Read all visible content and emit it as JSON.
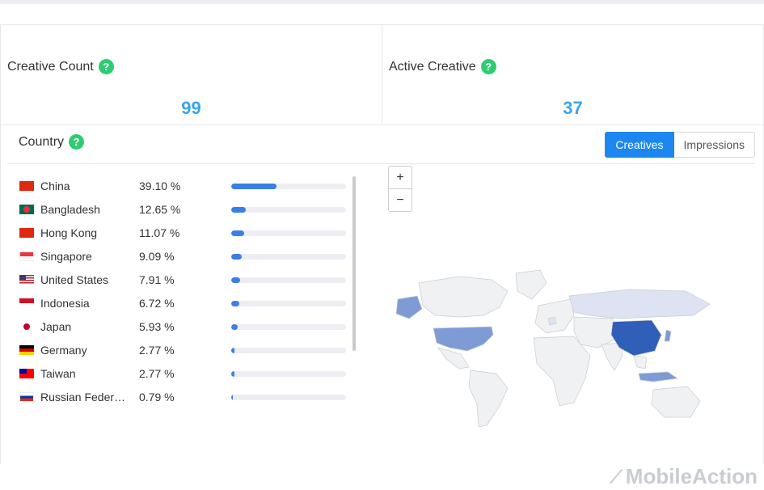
{
  "stats": {
    "creative_count": {
      "label": "Creative Count",
      "value": "99"
    },
    "active_creative": {
      "label": "Active Creative",
      "value": "37"
    }
  },
  "country_section": {
    "title": "Country",
    "toggle": {
      "creatives": "Creatives",
      "impressions": "Impressions",
      "selected": "Creatives"
    }
  },
  "countries": [
    {
      "name": "China",
      "percent": "39.10 %",
      "share": 0.391,
      "flag": "china-flag-icon"
    },
    {
      "name": "Bangladesh",
      "percent": "12.65 %",
      "share": 0.1265,
      "flag": "bangladesh-flag-icon"
    },
    {
      "name": "Hong Kong",
      "percent": "11.07 %",
      "share": 0.1107,
      "flag": "hong-kong-flag-icon"
    },
    {
      "name": "Singapore",
      "percent": "9.09 %",
      "share": 0.0909,
      "flag": "singapore-flag-icon"
    },
    {
      "name": "United States",
      "percent": "7.91 %",
      "share": 0.0791,
      "flag": "united-states-flag-icon"
    },
    {
      "name": "Indonesia",
      "percent": "6.72 %",
      "share": 0.0672,
      "flag": "indonesia-flag-icon"
    },
    {
      "name": "Japan",
      "percent": "5.93 %",
      "share": 0.0593,
      "flag": "japan-flag-icon"
    },
    {
      "name": "Germany",
      "percent": "2.77 %",
      "share": 0.0277,
      "flag": "germany-flag-icon"
    },
    {
      "name": "Taiwan",
      "percent": "2.77 %",
      "share": 0.0277,
      "flag": "taiwan-flag-icon"
    },
    {
      "name": "Russian Feder…",
      "percent": "0.79 %",
      "share": 0.0079,
      "flag": "russia-flag-icon"
    }
  ],
  "map": {
    "zoom_in": "+",
    "zoom_out": "−"
  },
  "colors": {
    "accent": "#1d87f0",
    "value": "#3aa4f0",
    "bar": "#3a7fe8",
    "help": "#2ecc71",
    "map_high": "#2f5fb8",
    "map_mid": "#7f9bd6",
    "map_low": "#dde3f3"
  },
  "watermark": "MobileAction"
}
